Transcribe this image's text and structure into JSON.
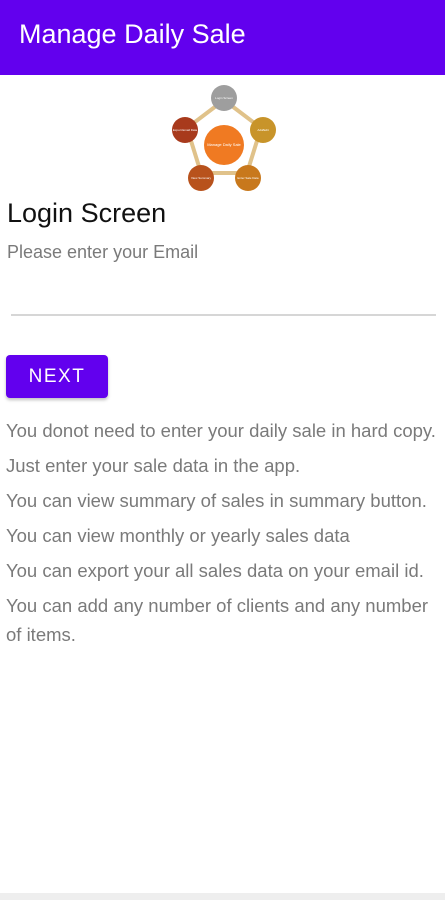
{
  "appbar": {
    "title": "Manage Daily Sale",
    "color": "#6200ee"
  },
  "logo": {
    "center_label": "Manage Daily Sale",
    "nodes": [
      "Login Screen",
      "Add/Edit",
      "Enter Sale Data",
      "View Summary",
      "Export Email Data"
    ],
    "node_colors": [
      "#9e9e9e",
      "#c8942a",
      "#c8781c",
      "#b8521c",
      "#a83a1c"
    ],
    "center_color": "#f07a22"
  },
  "login": {
    "title": "Login Screen",
    "email_label": "Please enter your Email",
    "email_value": "",
    "next_label": "NEXT"
  },
  "info": [
    "You donot need to enter your daily sale in hard copy.",
    "Just enter your sale data in the app.",
    "You can view summary of sales in summary button.",
    "You can view monthly or yearly sales data",
    "You can export your all sales data on your email id.",
    "You can add any number of clients and any number of items."
  ]
}
